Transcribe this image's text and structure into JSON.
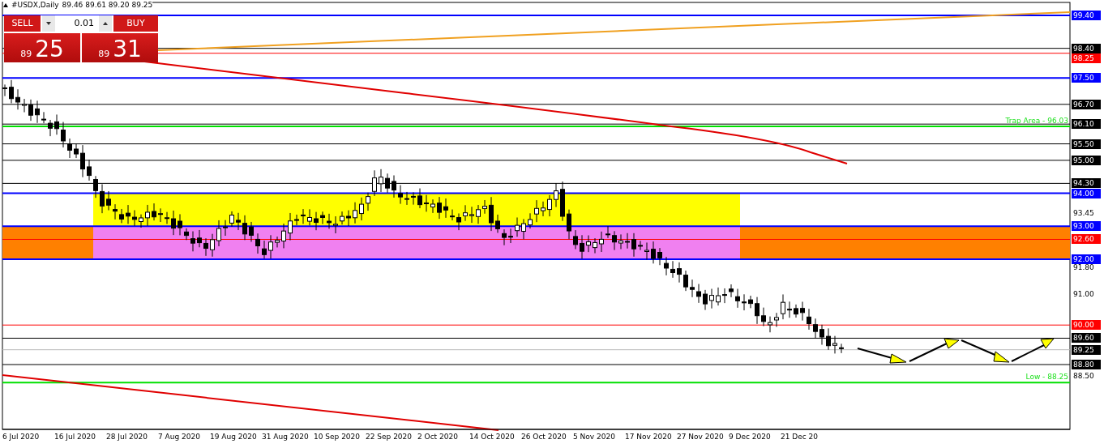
{
  "header": {
    "symbol": "#USDX,Daily",
    "ohlc": "89.46 89.61 89.20 89.25"
  },
  "trade_panel": {
    "sell_label": "SELL",
    "buy_label": "BUY",
    "lot": "0.01",
    "sell_price": {
      "small": "89",
      "big": "25"
    },
    "buy_price": {
      "small": "89",
      "big": "31"
    }
  },
  "levels": [
    {
      "tag": "99.40",
      "color": "#0000ff"
    },
    {
      "tag": "98.40",
      "color": "#000000"
    },
    {
      "tag": "98.25",
      "color": "#ff0000"
    },
    {
      "tag": "97.50",
      "color": "#0000ff"
    },
    {
      "tag": "96.70",
      "color": "#000000"
    },
    {
      "tag": "96.10",
      "color": "#000000"
    },
    {
      "tag": "95.50",
      "color": "#000000"
    },
    {
      "tag": "95.00",
      "color": "#000000"
    },
    {
      "tag": "94.30",
      "color": "#000000"
    },
    {
      "tag": "94.00",
      "color": "#0000ff"
    },
    {
      "tag": "93.00",
      "color": "#0000ff"
    },
    {
      "tag": "92.60",
      "color": "#ff0000"
    },
    {
      "tag": "92.00",
      "color": "#0000ff"
    },
    {
      "tag": "90.00",
      "color": "#ff0000"
    },
    {
      "tag": "89.60",
      "color": "#000000"
    },
    {
      "tag": "89.25",
      "color": "#000000"
    },
    {
      "tag": "88.80",
      "color": "#000000"
    }
  ],
  "marked_lines": [
    {
      "label": "Trap Area - 96.03"
    },
    {
      "label": "Low - 88.25"
    }
  ],
  "axis_ticks": [
    "93.45",
    "91.80",
    "91.00",
    "88.50"
  ],
  "dates": [
    "6 Jul 2020",
    "16 Jul 2020",
    "28 Jul 2020",
    "7 Aug 2020",
    "19 Aug 2020",
    "31 Aug 2020",
    "10 Sep 2020",
    "22 Sep 2020",
    "2 Oct 2020",
    "14 Oct 2020",
    "26 Oct 2020",
    "5 Nov 2020",
    "17 Nov 2020",
    "27 Nov 2020",
    "9 Dec 2020",
    "21 Dec 20"
  ]
}
